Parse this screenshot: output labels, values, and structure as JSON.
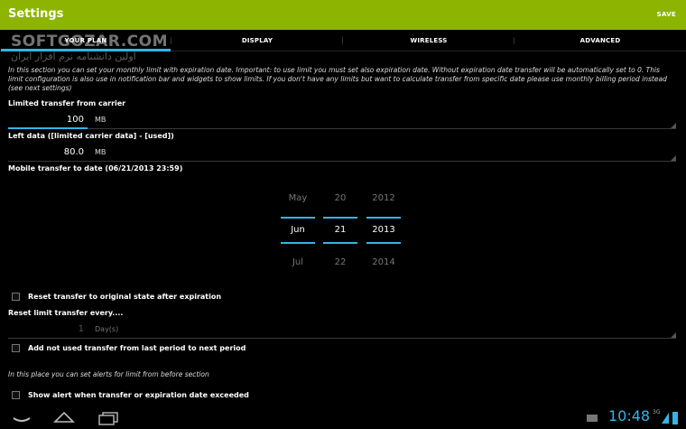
{
  "actionbar": {
    "title": "Settings",
    "save_label": "SAVE"
  },
  "watermark": {
    "text": "SOFTGOZAR.COM",
    "subtext": "اولین دانشنامه نرم افزار ایران"
  },
  "tabs": [
    {
      "label": "YOUR PLAN",
      "selected": true
    },
    {
      "label": "DISPLAY",
      "selected": false
    },
    {
      "label": "WIRELESS",
      "selected": false
    },
    {
      "label": "ADVANCED",
      "selected": false
    }
  ],
  "plan": {
    "intro": "In this section you can set your monthly limit with expiration date. Important: to use limit you must set also expiration date. Without expiration date transfer will be automatically set to 0. This limit configuration is also use in notification bar and widgets to show limits. If you don't have any limits but want to calculate transfer from specific date please use monthly billing period instead (see next settings)",
    "limited_label": "Limited transfer from carrier",
    "limited_value": "100",
    "limited_unit": "MB",
    "left_label": "Left data ([limited carrier data] - [used])",
    "left_value": "80.0",
    "left_unit": "MB",
    "date_label": "Mobile transfer to date (06/21/2013 23:59)",
    "picker": {
      "month": {
        "prev": "May",
        "current": "Jun",
        "next": "Jul"
      },
      "day": {
        "prev": "20",
        "current": "21",
        "next": "22"
      },
      "year": {
        "prev": "2012",
        "current": "2013",
        "next": "2014"
      }
    },
    "reset_label": "Reset transfer to original state after expiration",
    "reset_every_label": "Reset limit transfer every....",
    "reset_every_value": "1",
    "reset_every_unit": "Day(s)",
    "add_unused_label": "Add not used transfer from last period to next period",
    "alerts_info": "In this place you can set alerts for limit from before section",
    "show_alert_label": "Show alert when transfer or expiration date exceeded"
  },
  "statusbar": {
    "time": "10:48",
    "signal": "3G"
  },
  "colors": {
    "actionbar": "#8db500",
    "accent": "#33b5e5"
  }
}
